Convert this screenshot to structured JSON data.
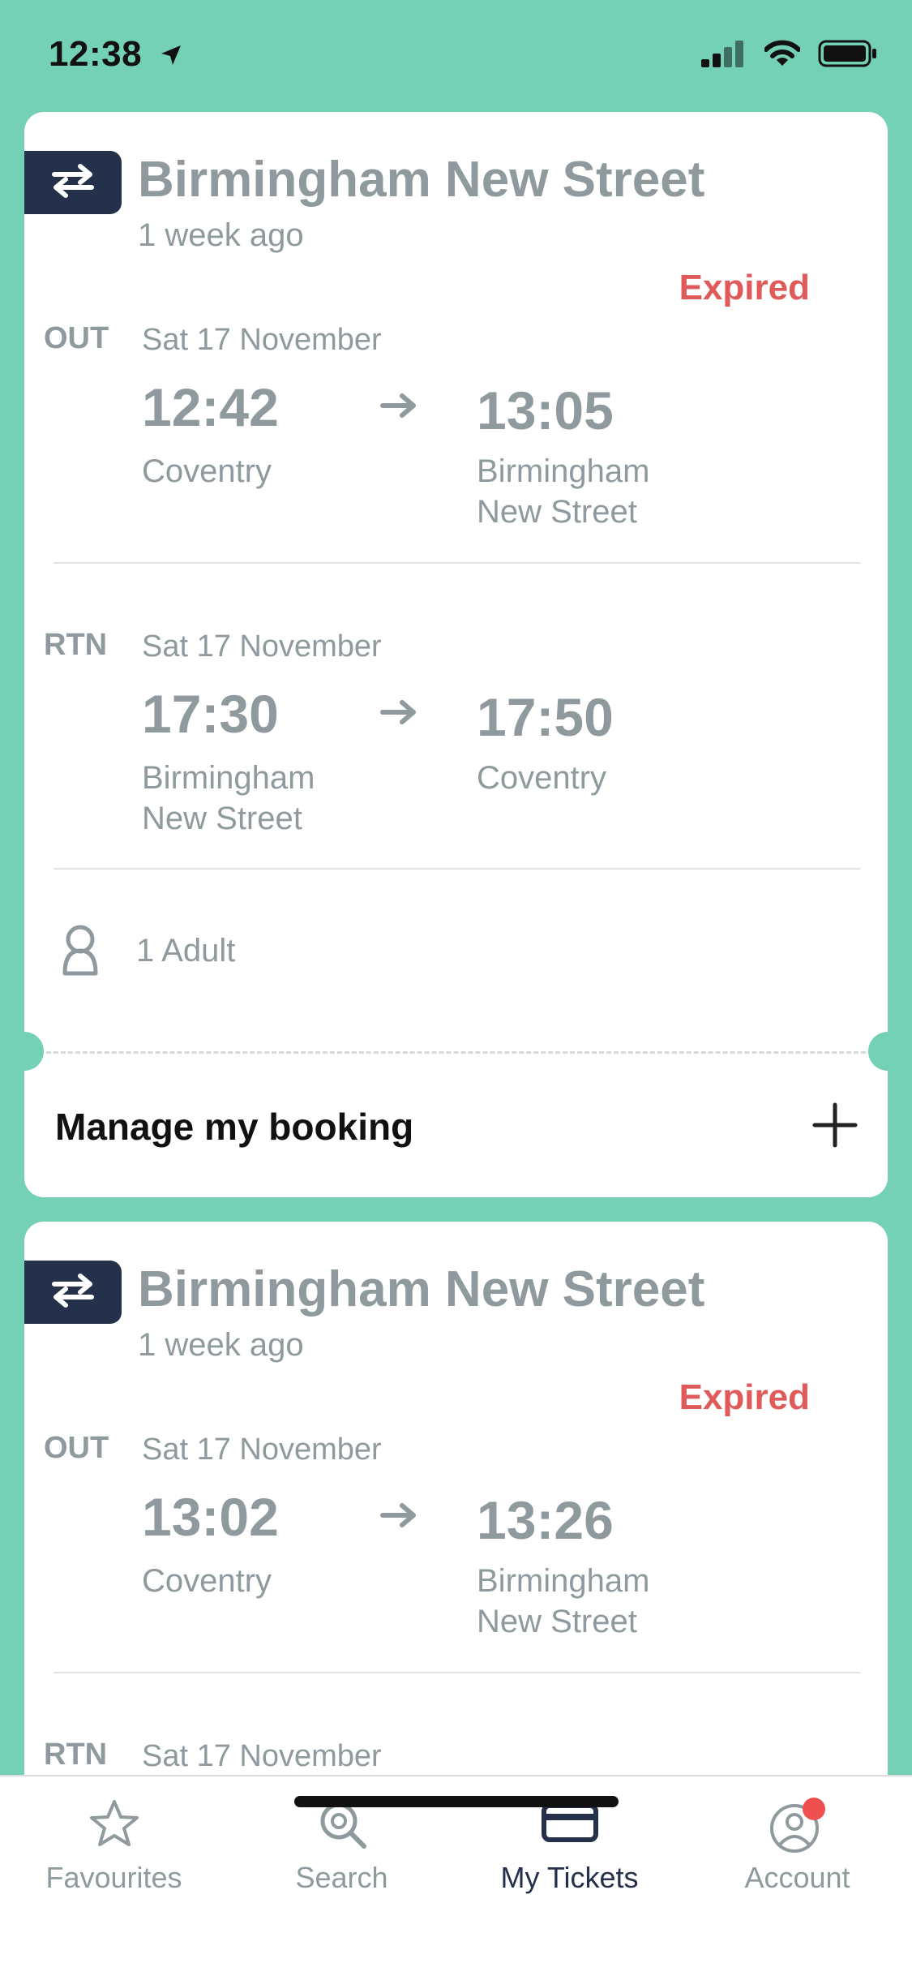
{
  "status_bar": {
    "time": "12:38"
  },
  "tickets": [
    {
      "destination": "Birmingham New Street",
      "age": "1 week ago",
      "status": "Expired",
      "legs": [
        {
          "label": "OUT",
          "date": "Sat 17 November",
          "dep_time": "12:42",
          "dep_station": "Coventry",
          "arr_time": "13:05",
          "arr_station": "Birmingham\nNew Street"
        },
        {
          "label": "RTN",
          "date": "Sat 17 November",
          "dep_time": "17:30",
          "dep_station": "Birmingham\nNew Street",
          "arr_time": "17:50",
          "arr_station": "Coventry"
        }
      ],
      "passengers": "1 Adult",
      "manage_label": "Manage my booking"
    },
    {
      "destination": "Birmingham New Street",
      "age": "1 week ago",
      "status": "Expired",
      "legs": [
        {
          "label": "OUT",
          "date": "Sat 17 November",
          "dep_time": "13:02",
          "dep_station": "Coventry",
          "arr_time": "13:26",
          "arr_station": "Birmingham\nNew Street"
        },
        {
          "label": "RTN",
          "date": "Sat 17 November"
        }
      ]
    }
  ],
  "tab_bar": {
    "items": [
      {
        "label": "Favourites",
        "icon": "star-icon"
      },
      {
        "label": "Search",
        "icon": "search-icon"
      },
      {
        "label": "My Tickets",
        "icon": "ticket-icon",
        "active": true
      },
      {
        "label": "Account",
        "icon": "account-icon",
        "badge": true
      }
    ]
  },
  "colors": {
    "background": "#75d1b5",
    "navy": "#25304a",
    "muted_text": "#8e9a9d",
    "expired": "#e05a5a",
    "badge": "#ee5050"
  }
}
